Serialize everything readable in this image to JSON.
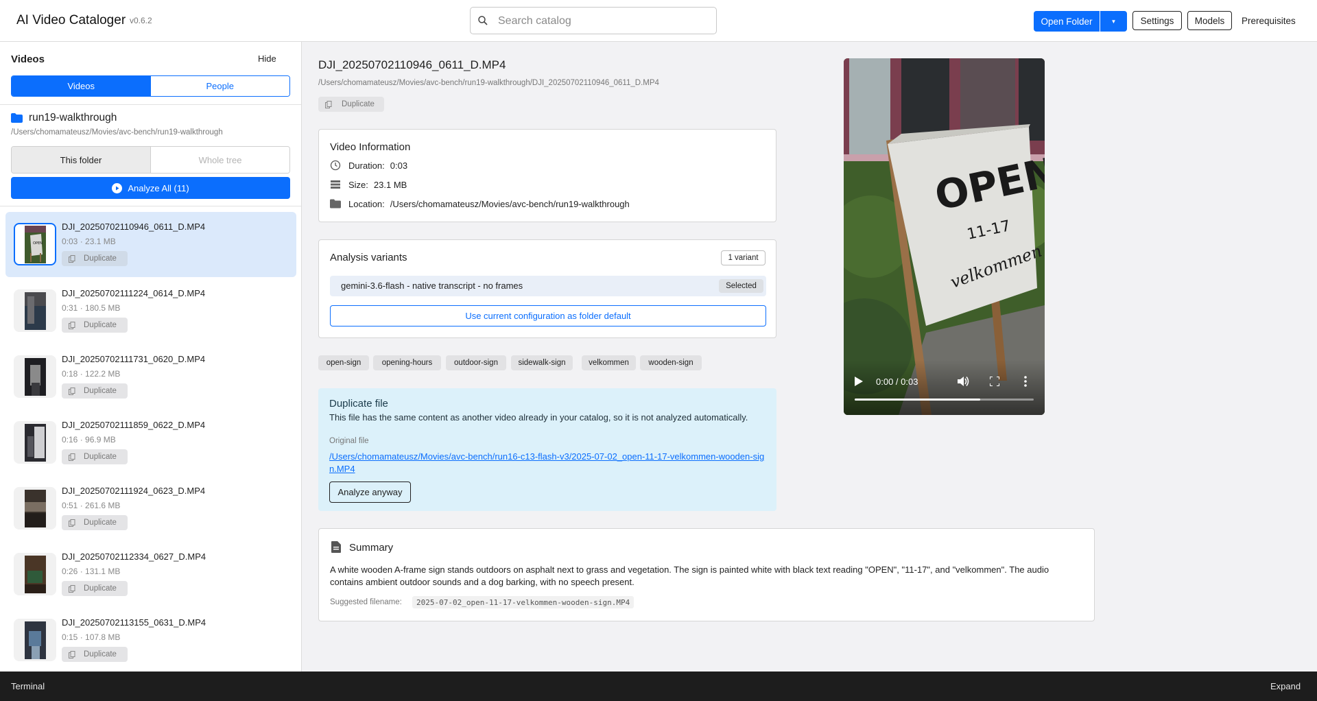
{
  "header": {
    "app_title": "AI Video Cataloger",
    "version": "v0.6.2",
    "search_placeholder": "Search catalog",
    "open_folder_label": "Open Folder",
    "settings_label": "Settings",
    "models_label": "Models",
    "prerequisites_label": "Prerequisites"
  },
  "sidebar": {
    "title": "Videos",
    "hide_label": "Hide",
    "tabs": [
      {
        "label": "Videos",
        "active": true
      },
      {
        "label": "People",
        "active": false
      }
    ],
    "folder": {
      "name": "run19-walkthrough",
      "path": "/Users/chomamateusz/Movies/avc-bench/run19-walkthrough"
    },
    "scope": [
      {
        "label": "This folder",
        "active": true
      },
      {
        "label": "Whole tree",
        "active": false
      }
    ],
    "analyze_all_label": "Analyze All (11)",
    "videos": [
      {
        "name": "DJI_20250702110946_0611_D.MP4",
        "meta": "0:03 · 23.1 MB",
        "badge": "Duplicate",
        "selected": true
      },
      {
        "name": "DJI_20250702111224_0614_D.MP4",
        "meta": "0:31 · 180.5 MB",
        "badge": "Duplicate",
        "selected": false
      },
      {
        "name": "DJI_20250702111731_0620_D.MP4",
        "meta": "0:18 · 122.2 MB",
        "badge": "Duplicate",
        "selected": false
      },
      {
        "name": "DJI_20250702111859_0622_D.MP4",
        "meta": "0:16 · 96.9 MB",
        "badge": "Duplicate",
        "selected": false
      },
      {
        "name": "DJI_20250702111924_0623_D.MP4",
        "meta": "0:51 · 261.6 MB",
        "badge": "Duplicate",
        "selected": false
      },
      {
        "name": "DJI_20250702112334_0627_D.MP4",
        "meta": "0:26 · 131.1 MB",
        "badge": "Duplicate",
        "selected": false
      },
      {
        "name": "DJI_20250702113155_0631_D.MP4",
        "meta": "0:15 · 107.8 MB",
        "badge": "Duplicate",
        "selected": false
      }
    ]
  },
  "main": {
    "file_title": "DJI_20250702110946_0611_D.MP4",
    "file_path": "/Users/chomamateusz/Movies/avc-bench/run19-walkthrough/DJI_20250702110946_0611_D.MP4",
    "duplicate_badge": "Duplicate",
    "info": {
      "title": "Video Information",
      "duration_label": "Duration:",
      "duration": "0:03",
      "size_label": "Size:",
      "size": "23.1 MB",
      "location_label": "Location:",
      "location": "/Users/chomamateusz/Movies/avc-bench/run19-walkthrough"
    },
    "variants": {
      "title": "Analysis variants",
      "count_label": "1 variant",
      "items": [
        {
          "name": "gemini-3.6-flash - native transcript - no frames",
          "badge": "Selected"
        }
      ],
      "use_default_label": "Use current configuration as folder default"
    },
    "tags": [
      "open-sign",
      "opening-hours",
      "outdoor-sign",
      "sidewalk-sign",
      "velkommen",
      "wooden-sign"
    ],
    "duplicate": {
      "title": "Duplicate file",
      "text": "This file has the same content as another video already in your catalog, so it is not analyzed automatically.",
      "original_label": "Original file",
      "original_path": "/Users/chomamateusz/Movies/avc-bench/run16-c13-flash-v3/2025-07-02_open-11-17-velkommen-wooden-sign.MP4",
      "analyze_anyway_label": "Analyze anyway"
    },
    "summary": {
      "title": "Summary",
      "text": "A white wooden A-frame sign stands outdoors on asphalt next to grass and vegetation. The sign is painted white with black text reading \"OPEN\", \"11-17\", and \"velkommen\". The audio contains ambient outdoor sounds and a dog barking, with no speech present.",
      "filename_label": "Suggested filename:",
      "filename": "2025-07-02_open-11-17-velkommen-wooden-sign.MP4"
    },
    "player": {
      "time": "0:00 / 0:03",
      "progress": 0.7,
      "sign_text": [
        "OPEN",
        "11-17",
        "velkommen"
      ]
    }
  },
  "terminal": {
    "label": "Terminal",
    "expand_label": "Expand"
  },
  "colors": {
    "accent": "#0b6efd",
    "selected_row": "#dbe9fb",
    "duplicate_panel": "#dcf1fa",
    "terminal_bg": "#1d1d1d"
  }
}
